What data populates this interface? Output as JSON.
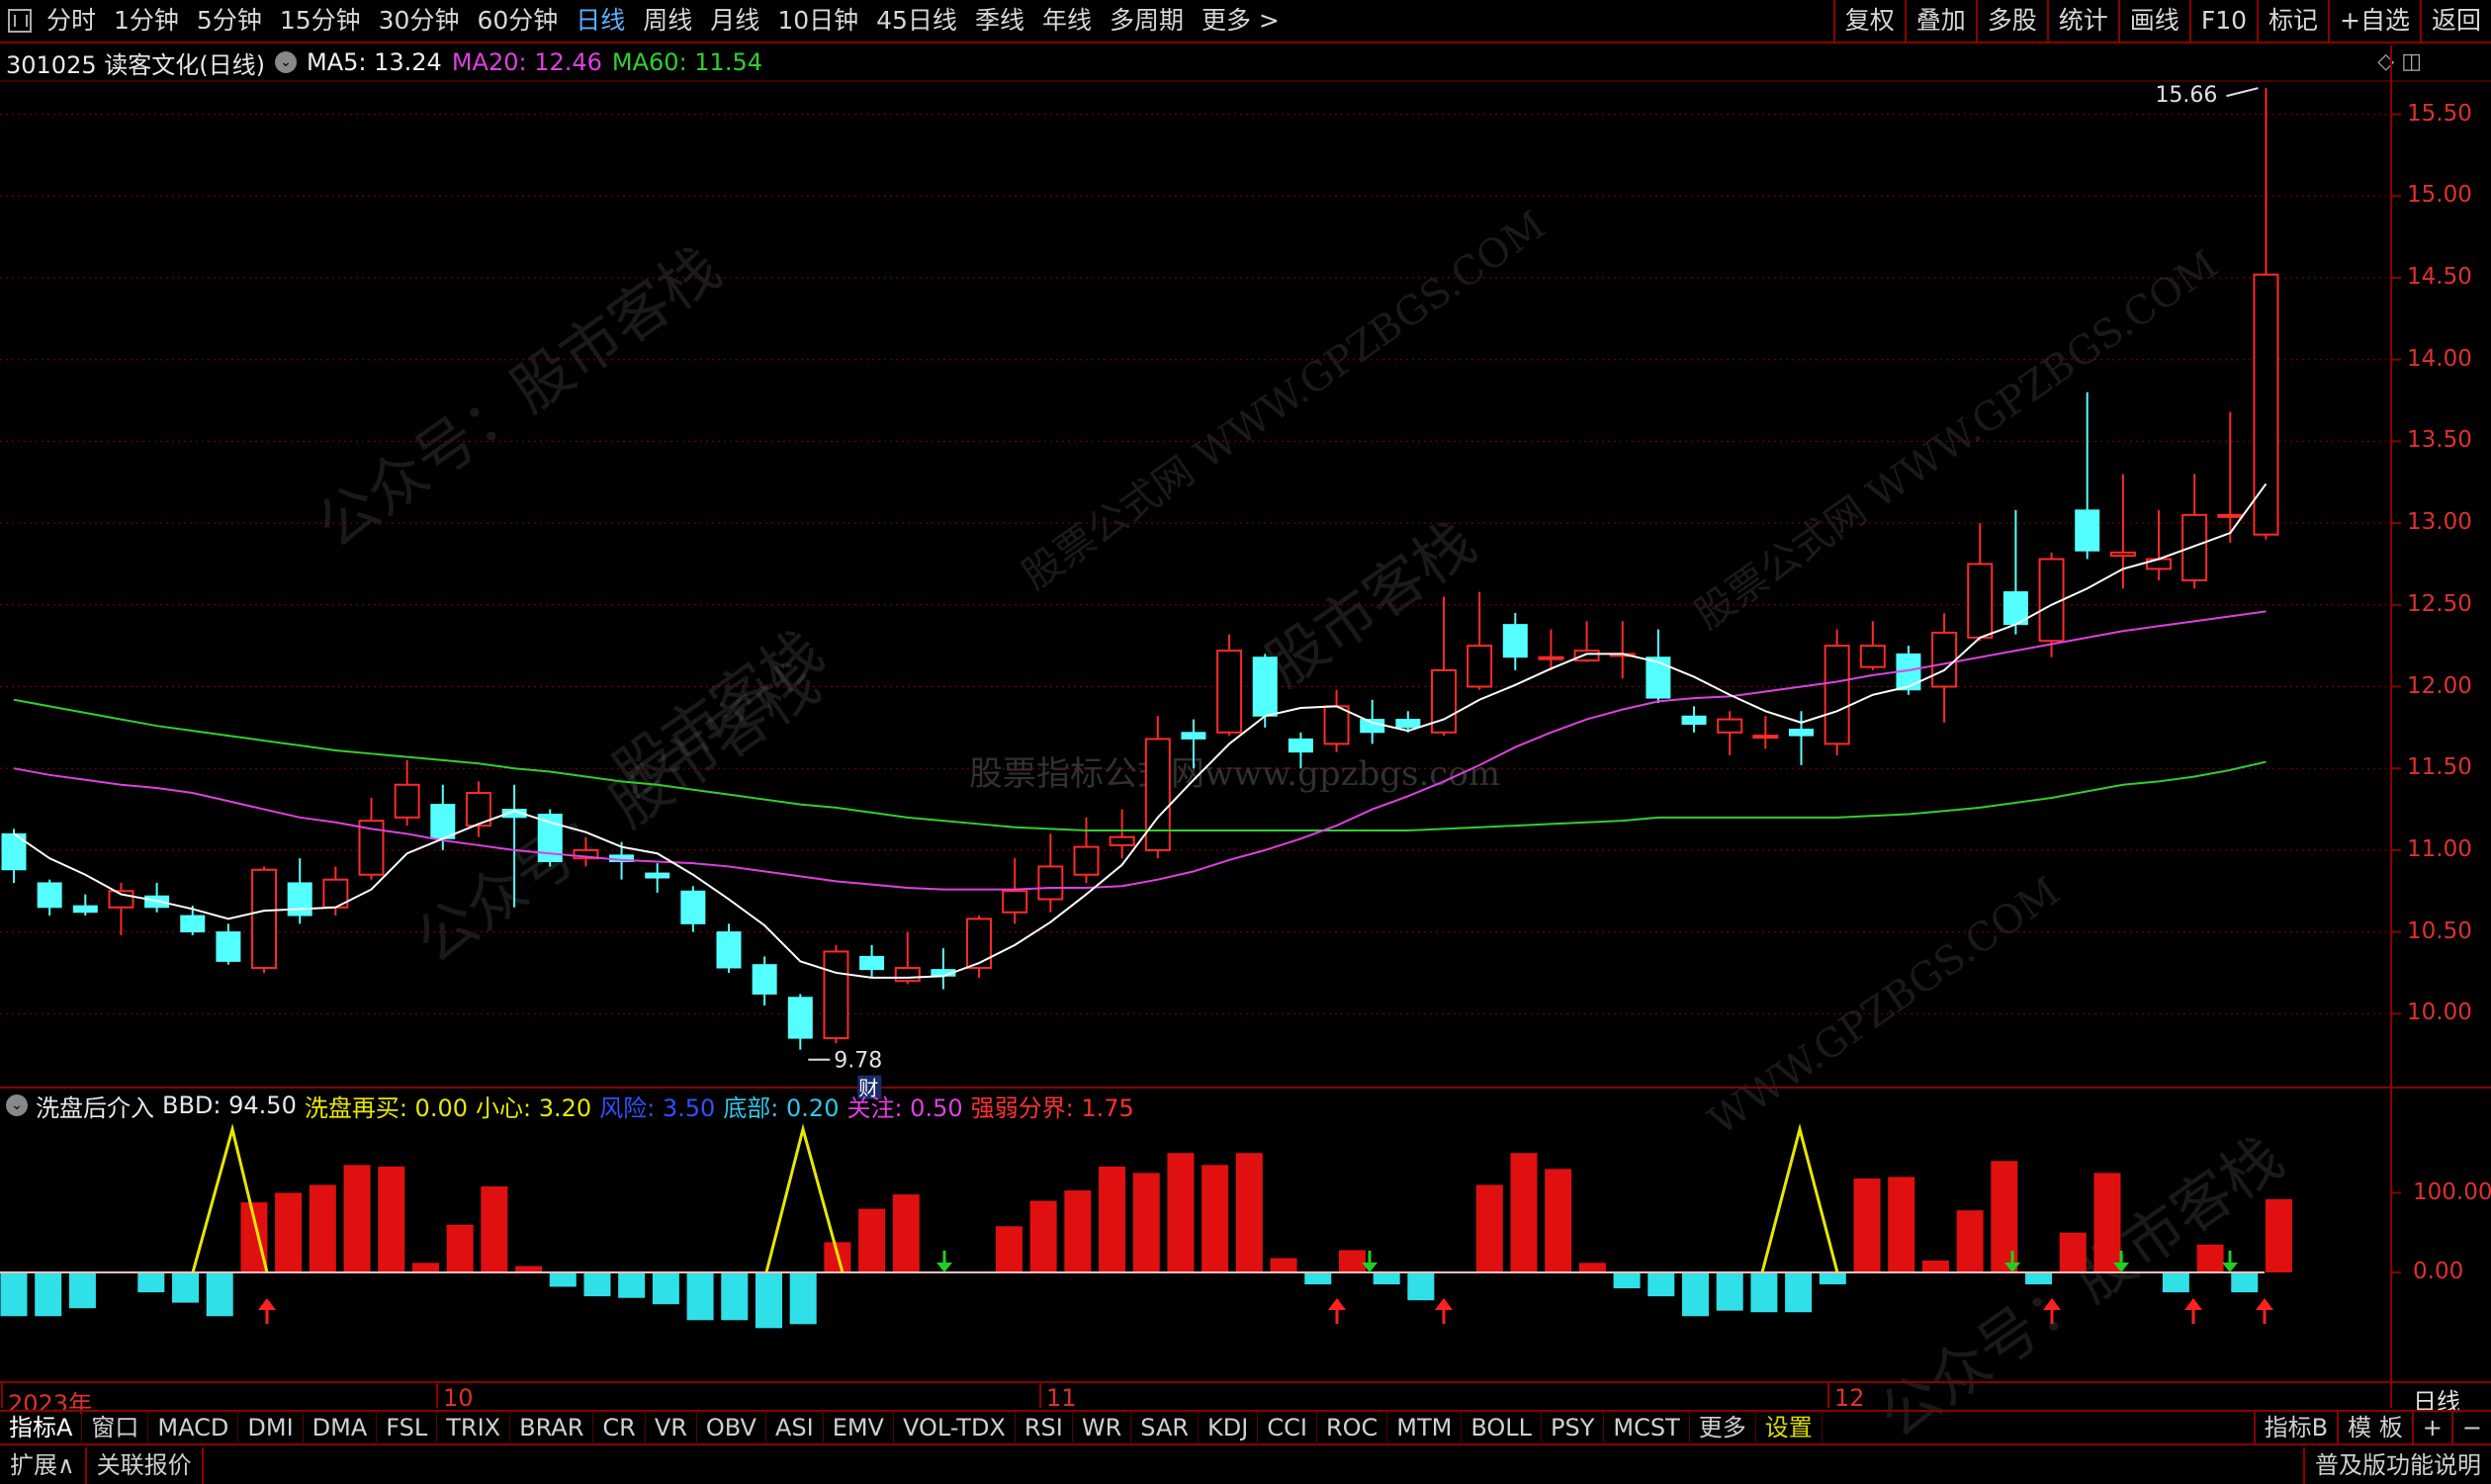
{
  "topbar": {
    "periods": [
      "分时",
      "1分钟",
      "5分钟",
      "15分钟",
      "30分钟",
      "60分钟",
      "日线",
      "周线",
      "月线",
      "10日钟",
      "45日线",
      "季线",
      "年线",
      "多周期",
      "更多 >"
    ],
    "active_period": "日线",
    "right_buttons": [
      "复权",
      "叠加",
      "多股",
      "统计",
      "画线",
      "F10",
      "标记",
      "+自选",
      "返回"
    ]
  },
  "info": {
    "stock": "301025 读客文化(日线)",
    "ma5": "MA5: 13.24",
    "ma20": "MA20: 12.46",
    "ma60": "MA60: 11.54",
    "right_icons": "◇ ◫"
  },
  "colors": {
    "up": "#ff2a2a",
    "down": "#54ffff",
    "ma5": "#ffffff",
    "ma20": "#e040e0",
    "ma60": "#30d030",
    "grid": "#8b0000",
    "axis": "#e03030",
    "yellow": "#e8e800"
  },
  "price_axis": {
    "min": 9.5,
    "max": 15.8,
    "ticks": [
      "15.50",
      "15.00",
      "14.50",
      "14.00",
      "13.50",
      "13.00",
      "12.50",
      "12.00",
      "11.50",
      "11.00",
      "10.50",
      "10.00"
    ]
  },
  "annotations": {
    "high": "15.66",
    "low": "9.78",
    "fin_mark": "财"
  },
  "dates": {
    "labels": [
      "2023年",
      "10",
      "11",
      "12",
      "日线"
    ]
  },
  "indicator": {
    "name": "洗盘后介入",
    "bbd": "BBD: 94.50",
    "xpzm": "洗盘再买: 0.00",
    "xx": "小心: 3.20",
    "fx": "风险: 3.50",
    "db": "底部: 0.20",
    "gz": "关注: 0.50",
    "qr": "强弱分界: 1.75",
    "ticks": [
      "100.00",
      "0.00"
    ]
  },
  "bottom_tabs": [
    "指标A",
    "窗口",
    "MACD",
    "DMI",
    "DMA",
    "FSL",
    "TRIX",
    "BRAR",
    "CR",
    "VR",
    "OBV",
    "ASI",
    "EMV",
    "VOL-TDX",
    "RSI",
    "WR",
    "SAR",
    "KDJ",
    "CCI",
    "ROC",
    "MTM",
    "BOLL",
    "PSY",
    "MCST",
    "更多",
    "设置"
  ],
  "bottom_right": [
    "指标B",
    "模 板",
    "+",
    "−"
  ],
  "status": {
    "left": [
      "扩展∧",
      "关联报价"
    ],
    "right": "普及版功能说明"
  },
  "watermarks": {
    "a": "公众号：股市客栈",
    "b": "股票公式网 WWW.GPZBGS.COM",
    "c": "股票指标公式网www.gpzbgs.com",
    "d": "股市客栈",
    "e": "WWW.GPZBGS.COM"
  },
  "chart_data": {
    "type": "candlestick",
    "title": "301025 读客文化(日线)",
    "candles": [
      {
        "o": 11.1,
        "c": 10.88,
        "h": 11.13,
        "l": 10.8
      },
      {
        "o": 10.8,
        "c": 10.65,
        "h": 10.82,
        "l": 10.6
      },
      {
        "o": 10.66,
        "c": 10.62,
        "h": 10.73,
        "l": 10.6
      },
      {
        "o": 10.65,
        "c": 10.75,
        "h": 10.8,
        "l": 10.48
      },
      {
        "o": 10.72,
        "c": 10.65,
        "h": 10.8,
        "l": 10.62
      },
      {
        "o": 10.6,
        "c": 10.5,
        "h": 10.66,
        "l": 10.48
      },
      {
        "o": 10.5,
        "c": 10.32,
        "h": 10.55,
        "l": 10.3
      },
      {
        "o": 10.28,
        "c": 10.88,
        "h": 10.9,
        "l": 10.25
      },
      {
        "o": 10.8,
        "c": 10.6,
        "h": 10.95,
        "l": 10.55
      },
      {
        "o": 10.65,
        "c": 10.82,
        "h": 10.9,
        "l": 10.6
      },
      {
        "o": 10.85,
        "c": 11.18,
        "h": 11.32,
        "l": 10.82
      },
      {
        "o": 11.2,
        "c": 11.4,
        "h": 11.55,
        "l": 11.15
      },
      {
        "o": 11.28,
        "c": 11.07,
        "h": 11.4,
        "l": 11.0
      },
      {
        "o": 11.15,
        "c": 11.35,
        "h": 11.42,
        "l": 11.08
      },
      {
        "o": 11.25,
        "c": 11.2,
        "h": 11.4,
        "l": 10.65
      },
      {
        "o": 11.22,
        "c": 10.93,
        "h": 11.25,
        "l": 10.9
      },
      {
        "o": 10.95,
        "c": 11.0,
        "h": 11.08,
        "l": 10.9
      },
      {
        "o": 10.97,
        "c": 10.93,
        "h": 11.05,
        "l": 10.82
      },
      {
        "o": 10.86,
        "c": 10.83,
        "h": 10.92,
        "l": 10.74
      },
      {
        "o": 10.75,
        "c": 10.55,
        "h": 10.78,
        "l": 10.5
      },
      {
        "o": 10.5,
        "c": 10.28,
        "h": 10.55,
        "l": 10.25
      },
      {
        "o": 10.3,
        "c": 10.12,
        "h": 10.35,
        "l": 10.05
      },
      {
        "o": 10.1,
        "c": 9.85,
        "h": 10.12,
        "l": 9.78
      },
      {
        "o": 9.85,
        "c": 10.38,
        "h": 10.42,
        "l": 9.82
      },
      {
        "o": 10.35,
        "c": 10.27,
        "h": 10.42,
        "l": 10.22
      },
      {
        "o": 10.2,
        "c": 10.28,
        "h": 10.5,
        "l": 10.18
      },
      {
        "o": 10.27,
        "c": 10.23,
        "h": 10.4,
        "l": 10.15
      },
      {
        "o": 10.28,
        "c": 10.58,
        "h": 10.6,
        "l": 10.22
      },
      {
        "o": 10.62,
        "c": 10.75,
        "h": 10.95,
        "l": 10.55
      },
      {
        "o": 10.7,
        "c": 10.9,
        "h": 11.1,
        "l": 10.62
      },
      {
        "o": 10.85,
        "c": 11.02,
        "h": 11.2,
        "l": 10.8
      },
      {
        "o": 11.03,
        "c": 11.08,
        "h": 11.25,
        "l": 10.95
      },
      {
        "o": 11.0,
        "c": 11.68,
        "h": 11.82,
        "l": 10.95
      },
      {
        "o": 11.72,
        "c": 11.68,
        "h": 11.8,
        "l": 11.5
      },
      {
        "o": 11.72,
        "c": 12.22,
        "h": 12.32,
        "l": 11.7
      },
      {
        "o": 12.18,
        "c": 11.82,
        "h": 12.2,
        "l": 11.75
      },
      {
        "o": 11.68,
        "c": 11.6,
        "h": 11.72,
        "l": 11.5
      },
      {
        "o": 11.65,
        "c": 11.88,
        "h": 11.98,
        "l": 11.6
      },
      {
        "o": 11.8,
        "c": 11.72,
        "h": 11.92,
        "l": 11.65
      },
      {
        "o": 11.8,
        "c": 11.75,
        "h": 11.85,
        "l": 11.72
      },
      {
        "o": 11.72,
        "c": 12.1,
        "h": 12.55,
        "l": 11.7
      },
      {
        "o": 12.0,
        "c": 12.25,
        "h": 12.58,
        "l": 11.98
      },
      {
        "o": 12.38,
        "c": 12.18,
        "h": 12.45,
        "l": 12.1
      },
      {
        "o": 12.18,
        "c": 12.18,
        "h": 12.35,
        "l": 12.1
      },
      {
        "o": 12.16,
        "c": 12.22,
        "h": 12.4,
        "l": 12.15
      },
      {
        "o": 12.2,
        "c": 12.2,
        "h": 12.4,
        "l": 12.05
      },
      {
        "o": 12.18,
        "c": 11.93,
        "h": 12.35,
        "l": 11.9
      },
      {
        "o": 11.82,
        "c": 11.77,
        "h": 11.88,
        "l": 11.72
      },
      {
        "o": 11.72,
        "c": 11.8,
        "h": 11.85,
        "l": 11.58
      },
      {
        "o": 11.7,
        "c": 11.7,
        "h": 11.82,
        "l": 11.62
      },
      {
        "o": 11.74,
        "c": 11.7,
        "h": 11.85,
        "l": 11.52
      },
      {
        "o": 11.65,
        "c": 12.25,
        "h": 12.35,
        "l": 11.58
      },
      {
        "o": 12.12,
        "c": 12.25,
        "h": 12.4,
        "l": 12.1
      },
      {
        "o": 12.2,
        "c": 11.98,
        "h": 12.25,
        "l": 11.95
      },
      {
        "o": 12.0,
        "c": 12.33,
        "h": 12.45,
        "l": 11.78
      },
      {
        "o": 12.3,
        "c": 12.75,
        "h": 13.0,
        "l": 12.28
      },
      {
        "o": 12.58,
        "c": 12.38,
        "h": 13.08,
        "l": 12.32
      },
      {
        "o": 12.28,
        "c": 12.78,
        "h": 12.82,
        "l": 12.18
      },
      {
        "o": 13.08,
        "c": 12.83,
        "h": 13.8,
        "l": 12.78
      },
      {
        "o": 12.8,
        "c": 12.82,
        "h": 13.3,
        "l": 12.6
      },
      {
        "o": 12.72,
        "c": 12.78,
        "h": 13.08,
        "l": 12.65
      },
      {
        "o": 12.65,
        "c": 13.05,
        "h": 13.3,
        "l": 12.6
      },
      {
        "o": 13.05,
        "c": 13.05,
        "h": 13.68,
        "l": 12.88
      },
      {
        "o": 12.93,
        "c": 14.52,
        "h": 15.66,
        "l": 12.9
      }
    ],
    "ma5": [
      11.1,
      10.95,
      10.85,
      10.73,
      10.69,
      10.64,
      10.58,
      10.63,
      10.64,
      10.65,
      10.76,
      10.98,
      11.07,
      11.16,
      11.24,
      11.17,
      11.11,
      11.02,
      10.98,
      10.85,
      10.7,
      10.54,
      10.32,
      10.25,
      10.22,
      10.22,
      10.23,
      10.31,
      10.42,
      10.56,
      10.73,
      10.91,
      11.2,
      11.43,
      11.65,
      11.82,
      11.87,
      11.88,
      11.78,
      11.73,
      11.8,
      11.92,
      12.01,
      12.11,
      12.2,
      12.2,
      12.15,
      12.06,
      11.95,
      11.85,
      11.78,
      11.85,
      11.95,
      12.0,
      12.1,
      12.3,
      12.38,
      12.5,
      12.6,
      12.72,
      12.78,
      12.86,
      12.94,
      13.24
    ],
    "ma20": [
      11.5,
      11.46,
      11.43,
      11.4,
      11.38,
      11.35,
      11.3,
      11.25,
      11.2,
      11.17,
      11.13,
      11.1,
      11.06,
      11.03,
      11.0,
      10.98,
      10.96,
      10.94,
      10.93,
      10.92,
      10.9,
      10.87,
      10.84,
      10.81,
      10.79,
      10.77,
      10.76,
      10.76,
      10.76,
      10.77,
      10.77,
      10.78,
      10.82,
      10.87,
      10.94,
      11.0,
      11.07,
      11.15,
      11.25,
      11.33,
      11.42,
      11.52,
      11.63,
      11.72,
      11.8,
      11.86,
      11.91,
      11.93,
      11.94,
      11.97,
      12.0,
      12.03,
      12.07,
      12.1,
      12.14,
      12.18,
      12.22,
      12.26,
      12.3,
      12.34,
      12.37,
      12.4,
      12.43,
      12.46
    ],
    "ma60": [
      11.92,
      11.88,
      11.84,
      11.8,
      11.76,
      11.73,
      11.7,
      11.67,
      11.64,
      11.61,
      11.59,
      11.57,
      11.55,
      11.53,
      11.5,
      11.48,
      11.45,
      11.42,
      11.4,
      11.37,
      11.34,
      11.31,
      11.28,
      11.26,
      11.23,
      11.2,
      11.18,
      11.16,
      11.14,
      11.13,
      11.12,
      11.12,
      11.12,
      11.12,
      11.12,
      11.12,
      11.12,
      11.12,
      11.12,
      11.12,
      11.13,
      11.14,
      11.15,
      11.16,
      11.17,
      11.18,
      11.2,
      11.2,
      11.2,
      11.2,
      11.2,
      11.2,
      11.21,
      11.22,
      11.24,
      11.26,
      11.29,
      11.32,
      11.36,
      11.4,
      11.42,
      11.45,
      11.49,
      11.54
    ],
    "indicator_bars": [
      -55,
      -55,
      -45,
      0,
      -25,
      -38,
      -55,
      88,
      100,
      110,
      135,
      133,
      12,
      60,
      108,
      8,
      -18,
      -30,
      -32,
      -40,
      -60,
      -60,
      -70,
      -65,
      38,
      80,
      98,
      0,
      0,
      58,
      90,
      103,
      133,
      125,
      150,
      135,
      150,
      18,
      -15,
      28,
      -15,
      -35,
      0,
      110,
      150,
      130,
      12,
      -20,
      -30,
      -55,
      -48,
      -50,
      -50,
      -15,
      118,
      120,
      15,
      78,
      140,
      -15,
      50,
      125,
      0,
      -25,
      35,
      -25,
      92
    ],
    "indicator_ylim": [
      -70,
      180
    ]
  }
}
